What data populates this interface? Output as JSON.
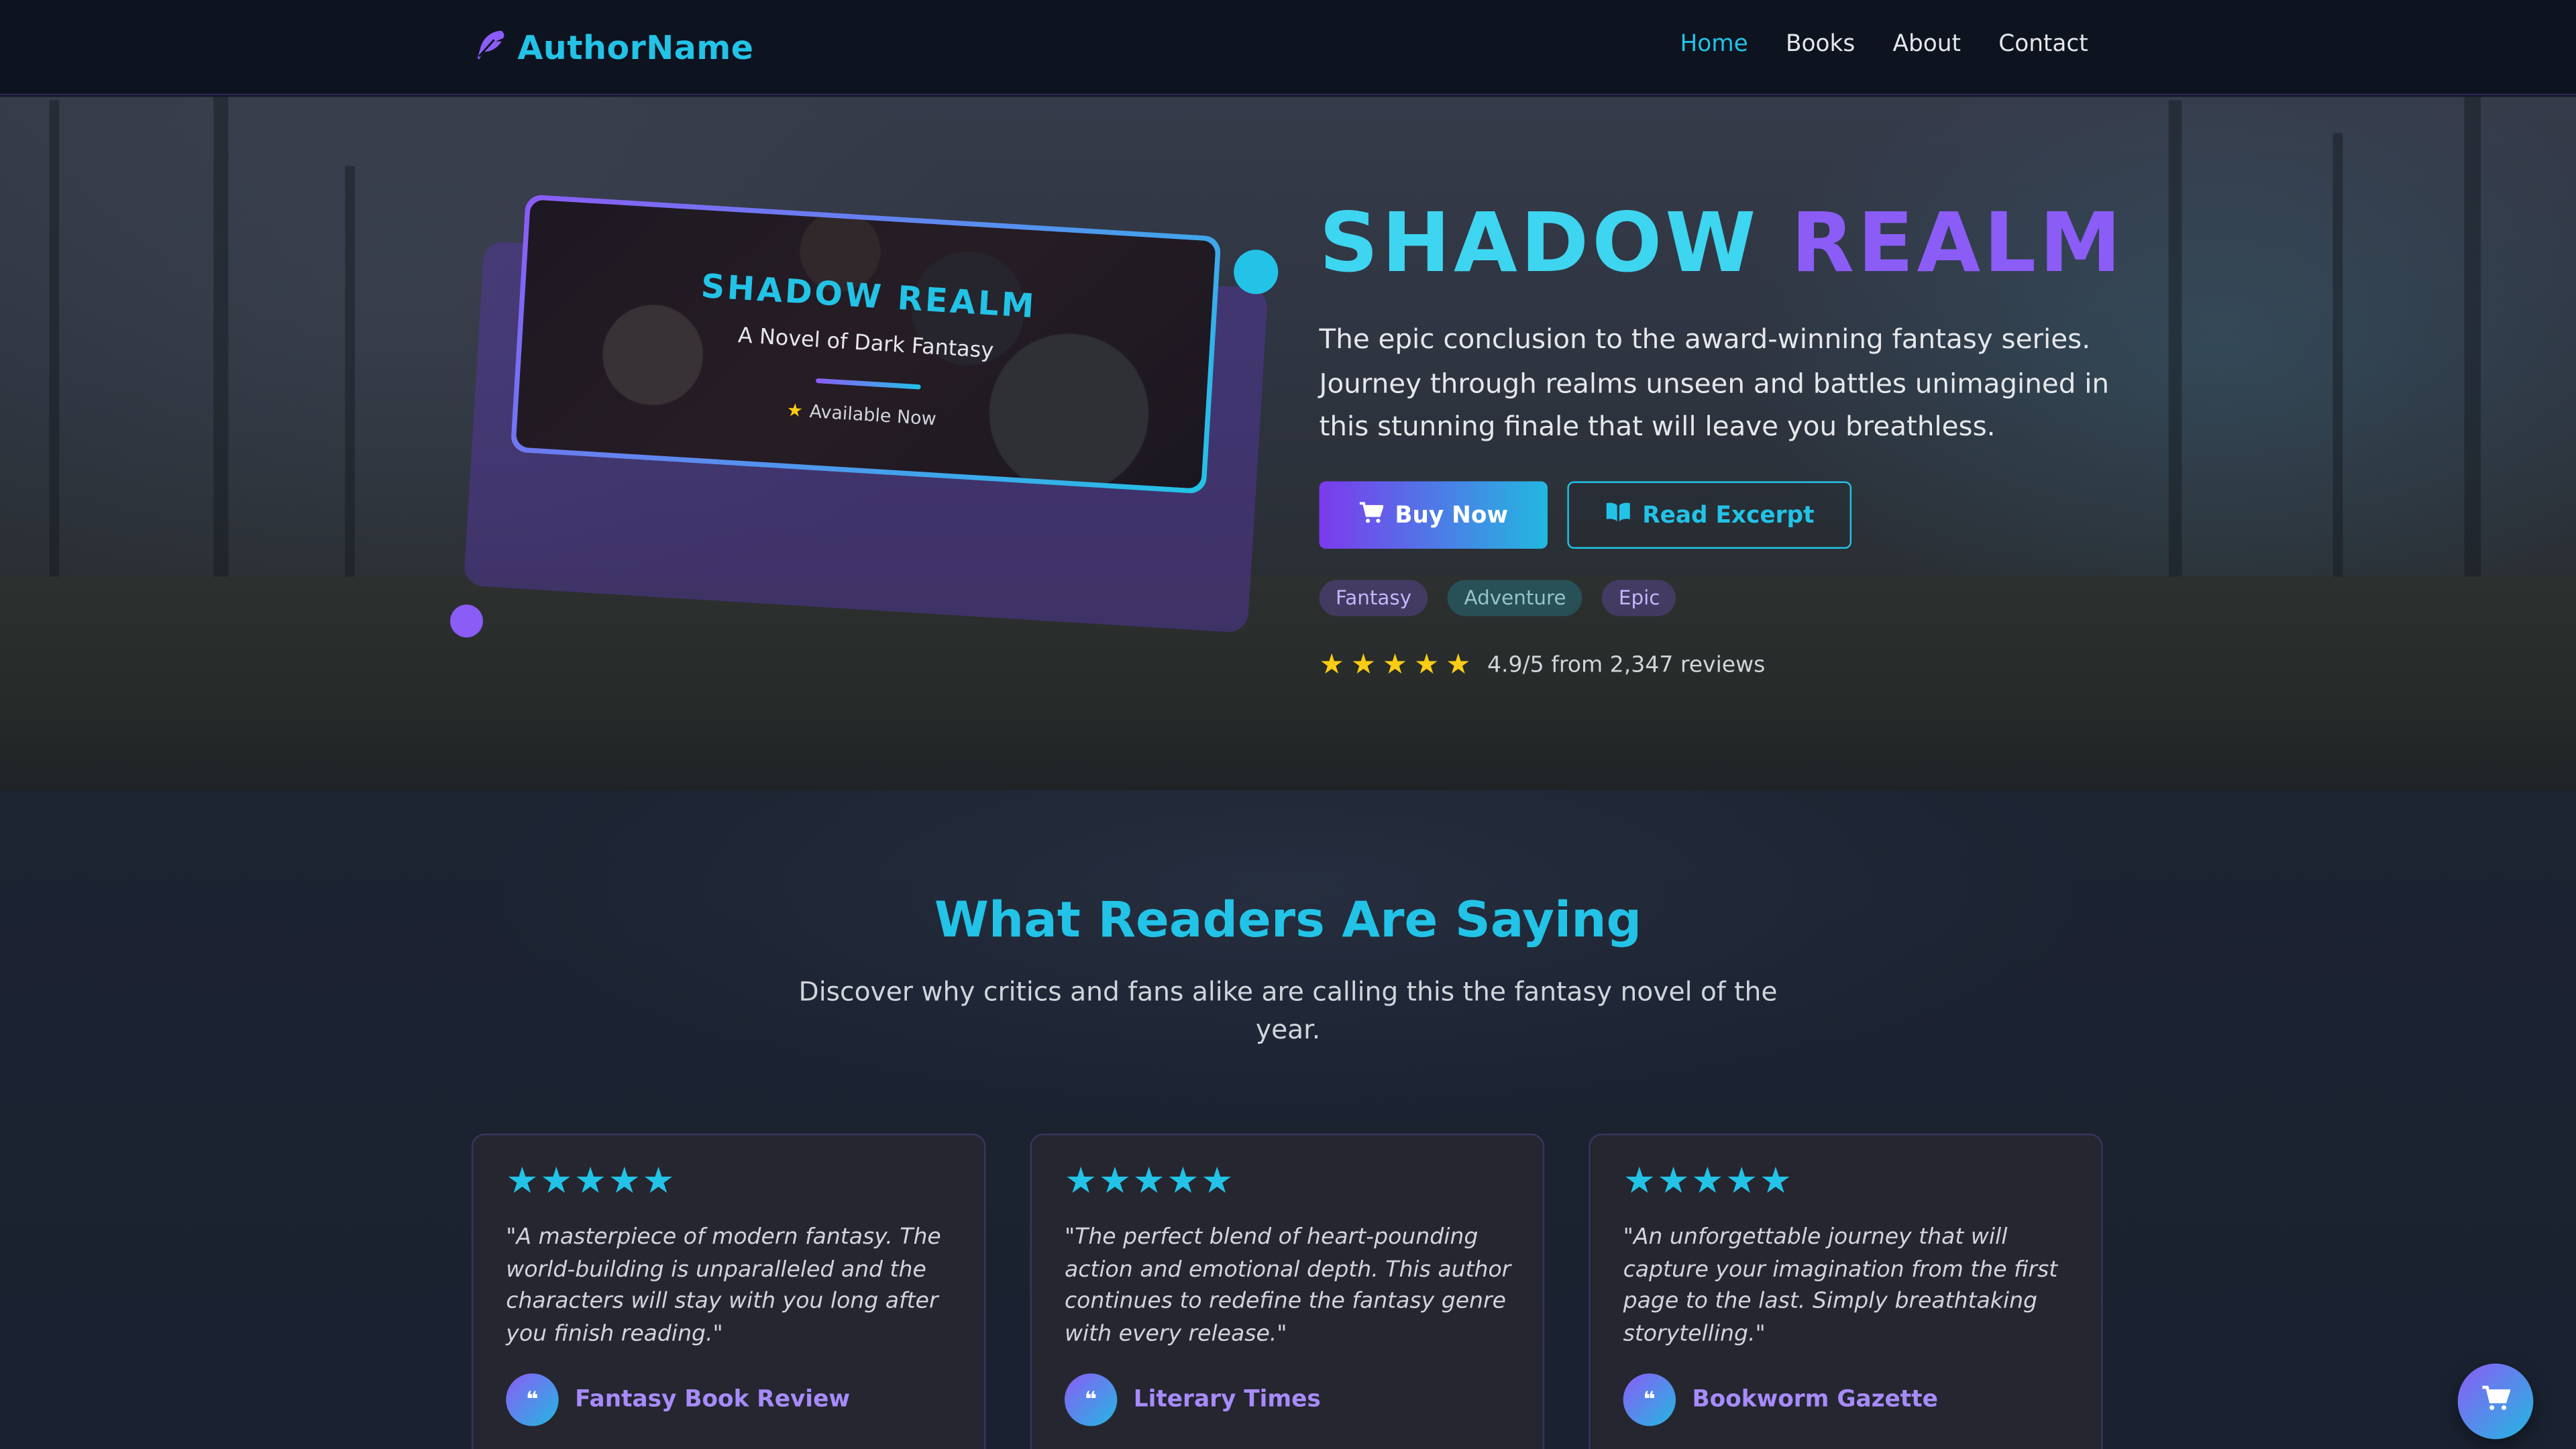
{
  "nav": {
    "brand": "AuthorName",
    "brand_icon": "feather-icon",
    "links": [
      "Home",
      "Books",
      "About",
      "Contact"
    ],
    "active": "Home"
  },
  "hero": {
    "cover": {
      "title": "SHADOW REALM",
      "subtitle": "A Novel of Dark Fantasy",
      "availability": "Available Now"
    },
    "title_part1": "SHADOW",
    "title_part2": "REALM",
    "description": "The epic conclusion to the award-winning fantasy series. Journey through realms unseen and battles unimagined in this stunning finale that will leave you breathless.",
    "buy_label": "Buy Now",
    "excerpt_label": "Read Excerpt",
    "tags": [
      "Fantasy",
      "Adventure",
      "Epic"
    ],
    "rating_stars": 5,
    "rating_text": "4.9/5 from 2,347 reviews"
  },
  "testimonials": {
    "heading": "What Readers Are Saying",
    "subheading": "Discover why critics and fans alike are calling this the fantasy novel of the year.",
    "items": [
      {
        "stars": 5,
        "quote": "\"A masterpiece of modern fantasy. The world-building is unparalleled and the characters will stay with you long after you finish reading.\"",
        "source": "Fantasy Book Review"
      },
      {
        "stars": 5,
        "quote": "\"The perfect blend of heart-pounding action and emotional depth. This author continues to redefine the fantasy genre with every release.\"",
        "source": "Literary Times"
      },
      {
        "stars": 5,
        "quote": "\"An unforgettable journey that will capture your imagination from the first page to the last. Simply breathtaking storytelling.\"",
        "source": "Bookworm Gazette"
      }
    ]
  },
  "colors": {
    "accent_cyan": "#22c3e6",
    "accent_purple": "#8b5cf6",
    "star_yellow": "#facc15"
  }
}
